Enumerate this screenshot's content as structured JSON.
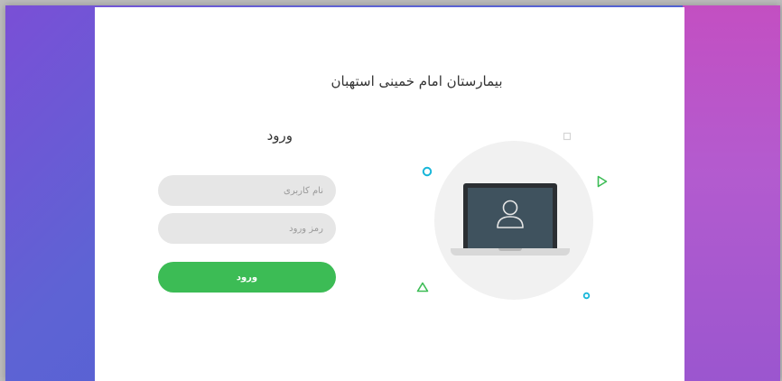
{
  "page": {
    "hospital_title": "بیمارستان امام خمینی استهبان"
  },
  "login_form": {
    "heading": "ورود",
    "username_placeholder": "نام کاربری",
    "password_placeholder": "رمز ورود",
    "submit_label": "ورود"
  },
  "colors": {
    "submit_button": "#3cbc55",
    "input_background": "#e6e6e6",
    "left_gradient_top": "#7a4fd6",
    "left_gradient_bottom": "#3e5fcf",
    "right_gradient_top": "#c34fc2",
    "right_gradient_bottom": "#9b56cf",
    "deco_cyan": "#17b6d9",
    "deco_green": "#3cbc55"
  },
  "illustration": {
    "icons": [
      "laptop-icon",
      "user-icon",
      "circle-outline-icon",
      "triangle-outline-icon",
      "square-outline-icon"
    ]
  }
}
